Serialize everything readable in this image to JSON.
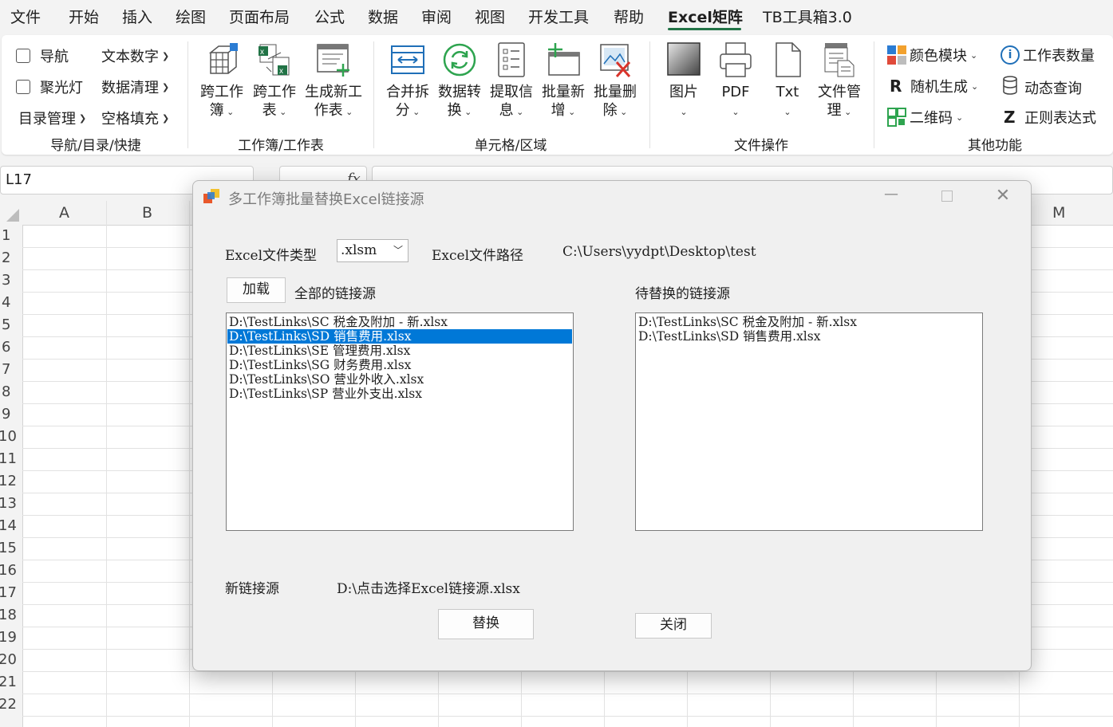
{
  "menubar": {
    "tabs": [
      "文件",
      "开始",
      "插入",
      "绘图",
      "页面布局",
      "公式",
      "数据",
      "审阅",
      "视图",
      "开发工具",
      "帮助",
      "Excel矩阵",
      "TB工具箱3.0"
    ],
    "active_tab": "Excel矩阵",
    "accent_color": "#217346"
  },
  "ribbon": {
    "nav": {
      "navigation": "导航",
      "spotlight": "聚光灯",
      "toc": "目录管理",
      "text_number": "文本数字",
      "data_clean": "数据清理",
      "fill_blank": "空格填充",
      "group_label": "导航/目录/快捷"
    },
    "workbook": {
      "cross_workbook": [
        "跨工作",
        "簿"
      ],
      "cross_sheet": [
        "跨工作",
        "表"
      ],
      "new_sheet": [
        "生成新工",
        "作表"
      ],
      "group_label": "工作簿/工作表"
    },
    "cells": {
      "merge_split": [
        "合并拆",
        "分"
      ],
      "convert": [
        "数据转",
        "换"
      ],
      "extract": [
        "提取信",
        "息"
      ],
      "batch_add": [
        "批量新",
        "增"
      ],
      "batch_delete": [
        "批量删",
        "除"
      ],
      "group_label": "单元格/区域"
    },
    "file_ops": {
      "picture": "图片",
      "pdf": "PDF",
      "txt": "Txt",
      "file_manage": [
        "文件管",
        "理"
      ],
      "group_label": "文件操作"
    },
    "other": {
      "color_block": "颜色模块",
      "random": "随机生成",
      "qrcode": "二维码",
      "sheet_count": "工作表数量",
      "dynamic_query": "动态查询",
      "regex": "正则表达式",
      "group_label": "其他功能"
    }
  },
  "formula_bar": {
    "name_box": "L17",
    "fx": "fx",
    "formula": ""
  },
  "sheet": {
    "columns": [
      "A",
      "B",
      "M"
    ],
    "rows": [
      "1",
      "2",
      "3",
      "4",
      "5",
      "6",
      "7",
      "8",
      "9",
      "10",
      "11",
      "12",
      "13",
      "14",
      "15",
      "16",
      "17",
      "18",
      "19",
      "20",
      "21",
      "22"
    ]
  },
  "dialog": {
    "title": "多工作簿批量替换Excel链接源",
    "file_type_label": "Excel文件类型",
    "file_type_value": ".xlsm",
    "file_path_label": "Excel文件路径",
    "file_path_value": "C:\\Users\\yydpt\\Desktop\\test",
    "load_button": "加载",
    "all_sources_label": "全部的链接源",
    "pending_label": "待替换的链接源",
    "all_sources": [
      "D:\\TestLinks\\SC 税金及附加 - 新.xlsx",
      "D:\\TestLinks\\SD 销售费用.xlsx",
      "D:\\TestLinks\\SE 管理费用.xlsx",
      "D:\\TestLinks\\SG 财务费用.xlsx",
      "D:\\TestLinks\\SO 营业外收入.xlsx",
      "D:\\TestLinks\\SP 营业外支出.xlsx"
    ],
    "selected_index": 1,
    "pending_sources": [
      "D:\\TestLinks\\SC 税金及附加 - 新.xlsx",
      "D:\\TestLinks\\SD 销售费用.xlsx"
    ],
    "new_source_label": "新链接源",
    "new_source_value": "D:\\点击选择Excel链接源.xlsx",
    "replace_button": "替换",
    "close_button": "关闭",
    "selection_color": "#0078d7"
  }
}
